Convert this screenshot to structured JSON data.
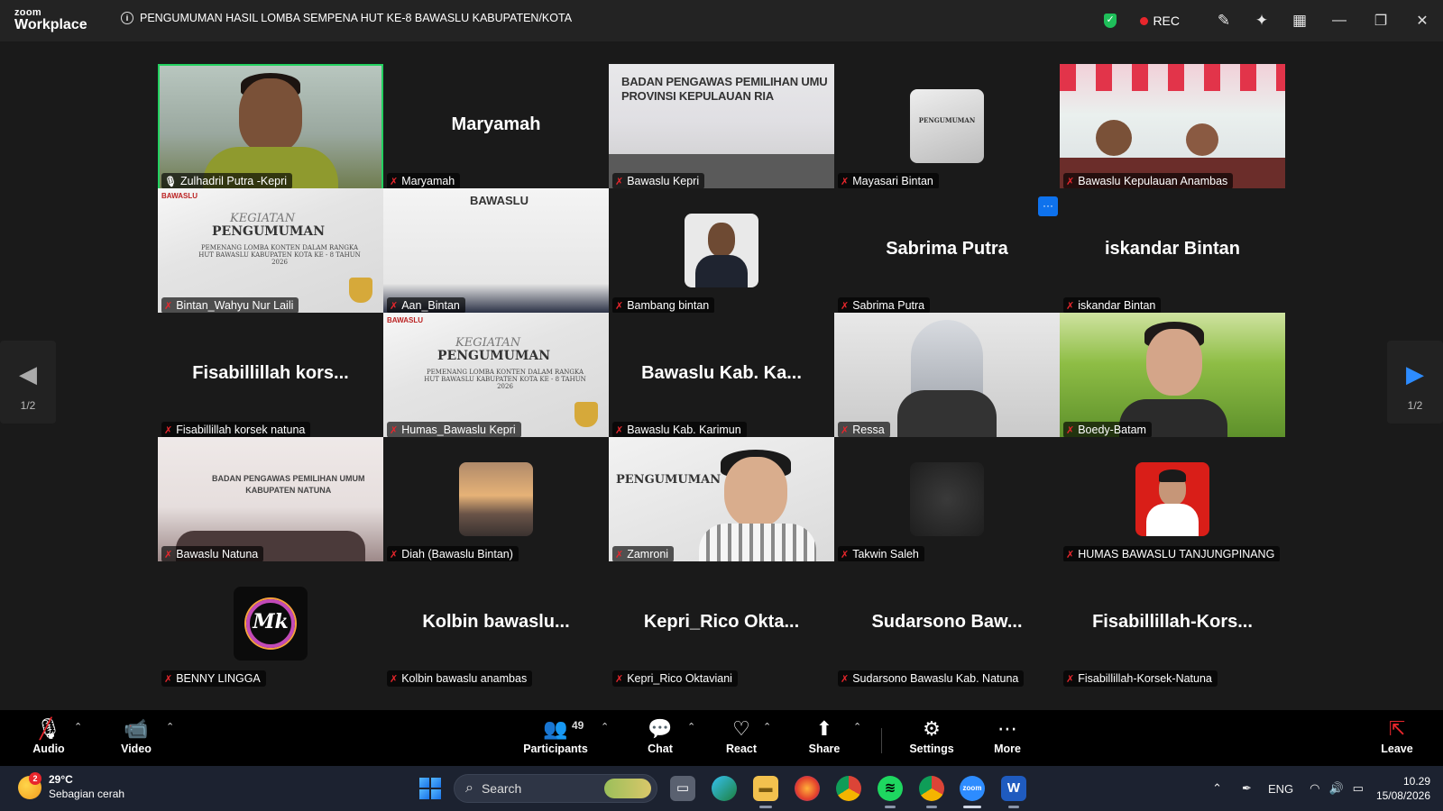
{
  "app": {
    "logo_top": "zoom",
    "logo_bottom": "Workplace",
    "meeting_title": "PENGUMUMAN HASIL LOMBA SEMPENA HUT KE-8 BAWASLU KABUPATEN/KOTA",
    "rec_label": "REC",
    "brand_color": "#0e72ed",
    "active_speaker_color": "#23d160",
    "muted_color": "#e8262c"
  },
  "gallery": {
    "page_indicator": "1/2",
    "tiles": [
      {
        "name": "Zulhadril Putra -Kepri",
        "kind": "video-person",
        "active": true
      },
      {
        "name": "Maryamah",
        "kind": "name-only",
        "display": "Maryamah"
      },
      {
        "name": "Bawaslu Kepri",
        "kind": "video-room",
        "banner_line1": "BADAN PENGAWAS PEMILIHAN UMU",
        "banner_line2": "PROVINSI KEPULAUAN RIA"
      },
      {
        "name": "Mayasari Bintan",
        "kind": "avatar-poster",
        "avatar_text": "PENGUMUMAN"
      },
      {
        "name": "Bawaslu Kepulauan Anambas",
        "kind": "video-festive"
      },
      {
        "name": "Bintan_Wahyu Nur Laili",
        "kind": "video-poster"
      },
      {
        "name": "Aan_Bintan",
        "kind": "video-slide",
        "slide_text": "BAWASLU"
      },
      {
        "name": "Bambang bintan",
        "kind": "avatar-man"
      },
      {
        "name": "Sabrima Putra",
        "kind": "name-only",
        "display": "Sabrima Putra"
      },
      {
        "name": "iskandar Bintan",
        "kind": "name-only",
        "display": "iskandar Bintan"
      },
      {
        "name": "Fisabillillah korsek natuna",
        "kind": "name-only",
        "display": "Fisabillillah  kors..."
      },
      {
        "name": "Humas_Bawaslu Kepri",
        "kind": "video-poster"
      },
      {
        "name": "Bawaslu Kab. Karimun",
        "kind": "name-only",
        "display": "Bawaslu  Kab.  Ka..."
      },
      {
        "name": "Ressa",
        "kind": "video-seal"
      },
      {
        "name": "Boedy-Batam",
        "kind": "video-bitmoji"
      },
      {
        "name": "Bawaslu Natuna",
        "kind": "video-meeting",
        "banner_line1": "BADAN PENGAWAS PEMILIHAN UMUM",
        "banner_line2": "KABUPATEN NATUNA"
      },
      {
        "name": "Diah (Bawaslu Bintan)",
        "kind": "avatar-sunset"
      },
      {
        "name": "Zamroni",
        "kind": "video-glasses"
      },
      {
        "name": "Takwin Saleh",
        "kind": "avatar-dark"
      },
      {
        "name": "HUMAS BAWASLU TANJUNGPINANG",
        "kind": "avatar-red"
      },
      {
        "name": "BENNY LINGGA",
        "kind": "avatar-mk",
        "avatar_text": "Mk"
      },
      {
        "name": "Kolbin bawaslu anambas",
        "kind": "name-only",
        "display": "Kolbin  bawaslu..."
      },
      {
        "name": "Kepri_Rico Oktaviani",
        "kind": "name-only",
        "display": "Kepri_Rico  Okta..."
      },
      {
        "name": "Sudarsono Bawaslu Kab. Natuna",
        "kind": "name-only",
        "display": "Sudarsono  Baw..."
      },
      {
        "name": "Fisabillillah-Korsek-Natuna",
        "kind": "name-only",
        "display": "Fisabillillah-Kors..."
      }
    ],
    "poster": {
      "brand": "BAWASLU",
      "kicker": "KEGIATAN",
      "title": "PENGUMUMAN",
      "subtitle": "PEMENANG LOMBA KONTEN DALAM RANGKA HUT BAWASLU KABUPATEN KOTA KE - 8 TAHUN 2026"
    }
  },
  "toolbar": {
    "audio": "Audio",
    "video": "Video",
    "participants": "Participants",
    "participants_count": "49",
    "chat": "Chat",
    "react": "React",
    "share": "Share",
    "settings": "Settings",
    "more": "More",
    "leave": "Leave"
  },
  "taskbar": {
    "weather_temp": "29°C",
    "weather_desc": "Sebagian cerah",
    "weather_badge": "2",
    "search_placeholder": "Search",
    "language": "ENG",
    "time": "10.29",
    "date": "15/08/2026"
  }
}
